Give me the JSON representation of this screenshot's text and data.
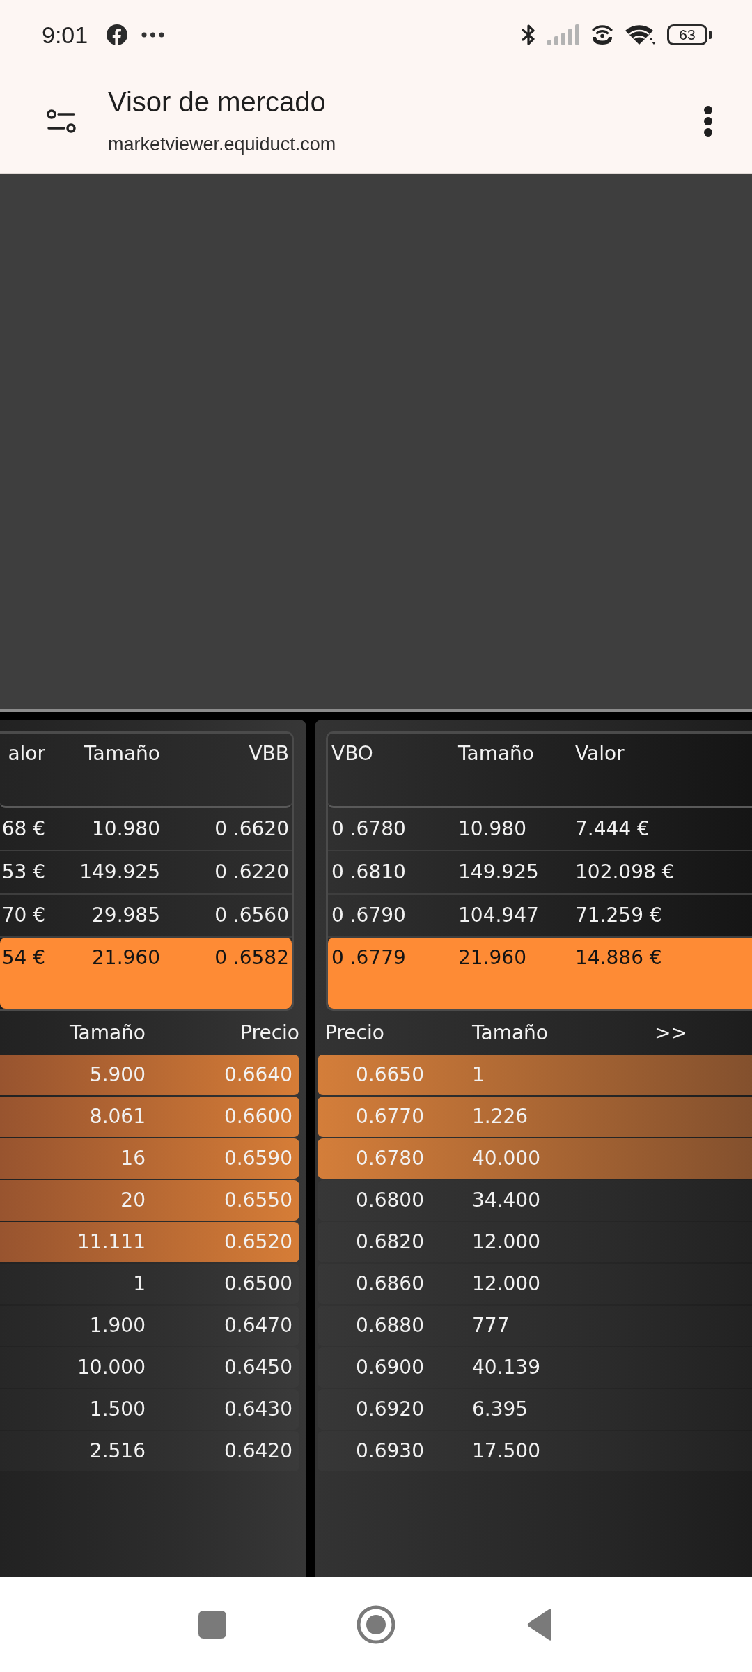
{
  "status_bar": {
    "time": "9:01",
    "battery": "63"
  },
  "browser": {
    "title": "Visor de mercado",
    "url": "marketviewer.equiduct.com"
  },
  "panels": [
    {
      "kind": "bid",
      "quote": {
        "columns": [
          "alor",
          "Tamaño",
          "VBB"
        ],
        "rows": [
          {
            "cells": [
              "68 €",
              "10.980",
              "0 .6620"
            ],
            "highlighted": false
          },
          {
            "cells": [
              "53 €",
              "149.925",
              "0 .6220"
            ],
            "highlighted": false
          },
          {
            "cells": [
              "70 €",
              "29.985",
              "0 .6560"
            ],
            "highlighted": false
          },
          {
            "cells": [
              "54 €",
              "21.960",
              "0 .6582"
            ],
            "highlighted": true
          }
        ]
      },
      "book": {
        "columns": [
          "Tamaño",
          "Precio"
        ],
        "rows": [
          {
            "cells": [
              "5.900",
              "0.6640"
            ],
            "highlighted": true
          },
          {
            "cells": [
              "8.061",
              "0.6600"
            ],
            "highlighted": true
          },
          {
            "cells": [
              "16",
              "0.6590"
            ],
            "highlighted": true
          },
          {
            "cells": [
              "20",
              "0.6550"
            ],
            "highlighted": true
          },
          {
            "cells": [
              "11.111",
              "0.6520"
            ],
            "highlighted": true
          },
          {
            "cells": [
              "1",
              "0.6500"
            ],
            "highlighted": false
          },
          {
            "cells": [
              "1.900",
              "0.6470"
            ],
            "highlighted": false
          },
          {
            "cells": [
              "10.000",
              "0.6450"
            ],
            "highlighted": false
          },
          {
            "cells": [
              "1.500",
              "0.6430"
            ],
            "highlighted": false
          },
          {
            "cells": [
              "2.516",
              "0.6420"
            ],
            "highlighted": false
          }
        ]
      }
    },
    {
      "kind": "ask",
      "quote": {
        "columns": [
          "VBO",
          "Tamaño",
          "Valor"
        ],
        "rows": [
          {
            "cells": [
              "0 .6780",
              "10.980",
              "7.444 €"
            ],
            "highlighted": false
          },
          {
            "cells": [
              "0 .6810",
              "149.925",
              "102.098 €"
            ],
            "highlighted": false
          },
          {
            "cells": [
              "0 .6790",
              "104.947",
              "71.259 €"
            ],
            "highlighted": false
          },
          {
            "cells": [
              "0 .6779",
              "21.960",
              "14.886 €"
            ],
            "highlighted": true
          }
        ]
      },
      "book": {
        "columns": [
          "Precio",
          "Tamaño"
        ],
        "expand": ">>",
        "rows": [
          {
            "cells": [
              "0.6650",
              "1"
            ],
            "highlighted": true
          },
          {
            "cells": [
              "0.6770",
              "1.226"
            ],
            "highlighted": true
          },
          {
            "cells": [
              "0.6780",
              "40.000"
            ],
            "highlighted": true
          },
          {
            "cells": [
              "0.6800",
              "34.400"
            ],
            "highlighted": false
          },
          {
            "cells": [
              "0.6820",
              "12.000"
            ],
            "highlighted": false
          },
          {
            "cells": [
              "0.6860",
              "12.000"
            ],
            "highlighted": false
          },
          {
            "cells": [
              "0.6880",
              "777"
            ],
            "highlighted": false
          },
          {
            "cells": [
              "0.6900",
              "40.139"
            ],
            "highlighted": false
          },
          {
            "cells": [
              "0.6920",
              "6.395"
            ],
            "highlighted": false
          },
          {
            "cells": [
              "0.6930",
              "17.500"
            ],
            "highlighted": false
          }
        ]
      }
    }
  ]
}
